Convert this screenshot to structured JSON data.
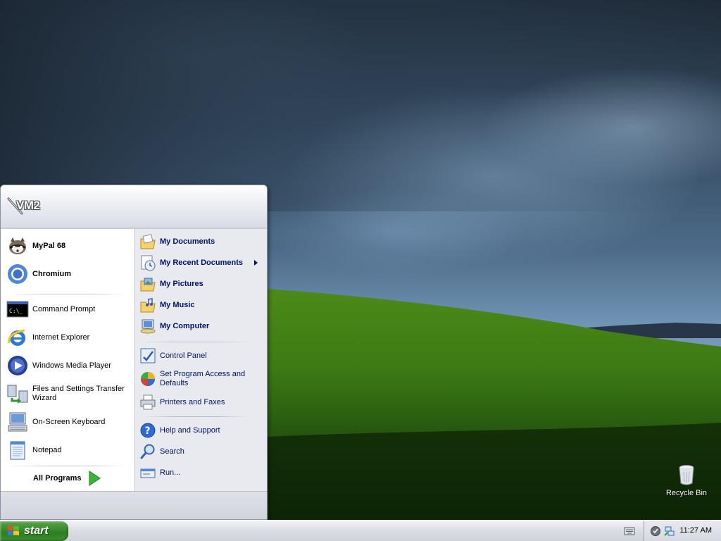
{
  "desktop": {
    "recycle_bin_label": "Recycle Bin"
  },
  "start_menu": {
    "user_name": "VM2",
    "pinned": [
      {
        "label": "MyPal 68",
        "icon": "raccoon-icon"
      },
      {
        "label": "Chromium",
        "icon": "chromium-icon"
      }
    ],
    "recent": [
      {
        "label": "Command Prompt",
        "icon": "command-prompt-icon"
      },
      {
        "label": "Internet Explorer",
        "icon": "internet-explorer-icon"
      },
      {
        "label": "Windows Media Player",
        "icon": "media-player-icon"
      },
      {
        "label": "Files and Settings Transfer Wizard",
        "icon": "transfer-wizard-icon"
      },
      {
        "label": "On-Screen Keyboard",
        "icon": "onscreen-keyboard-icon"
      },
      {
        "label": "Notepad",
        "icon": "notepad-icon"
      }
    ],
    "all_programs_label": "All Programs",
    "places": [
      {
        "label": "My Documents",
        "icon": "my-documents-icon"
      },
      {
        "label": "My Recent Documents",
        "icon": "recent-documents-icon",
        "submenu": true
      },
      {
        "label": "My Pictures",
        "icon": "my-pictures-icon"
      },
      {
        "label": "My Music",
        "icon": "my-music-icon"
      },
      {
        "label": "My Computer",
        "icon": "my-computer-icon"
      }
    ],
    "settings": [
      {
        "label": "Control Panel",
        "icon": "control-panel-icon"
      },
      {
        "label": "Set Program Access and Defaults",
        "icon": "program-defaults-icon"
      },
      {
        "label": "Printers and Faxes",
        "icon": "printer-icon"
      }
    ],
    "help": [
      {
        "label": "Help and Support",
        "icon": "help-icon"
      },
      {
        "label": "Search",
        "icon": "search-icon"
      },
      {
        "label": "Run...",
        "icon": "run-icon"
      }
    ]
  },
  "taskbar": {
    "start_label": "start",
    "clock": "11:27 AM"
  },
  "colors": {
    "start_green": "#3a8c2e",
    "right_link": "#00136b",
    "right_pane_bg": "#e8eaf0"
  }
}
